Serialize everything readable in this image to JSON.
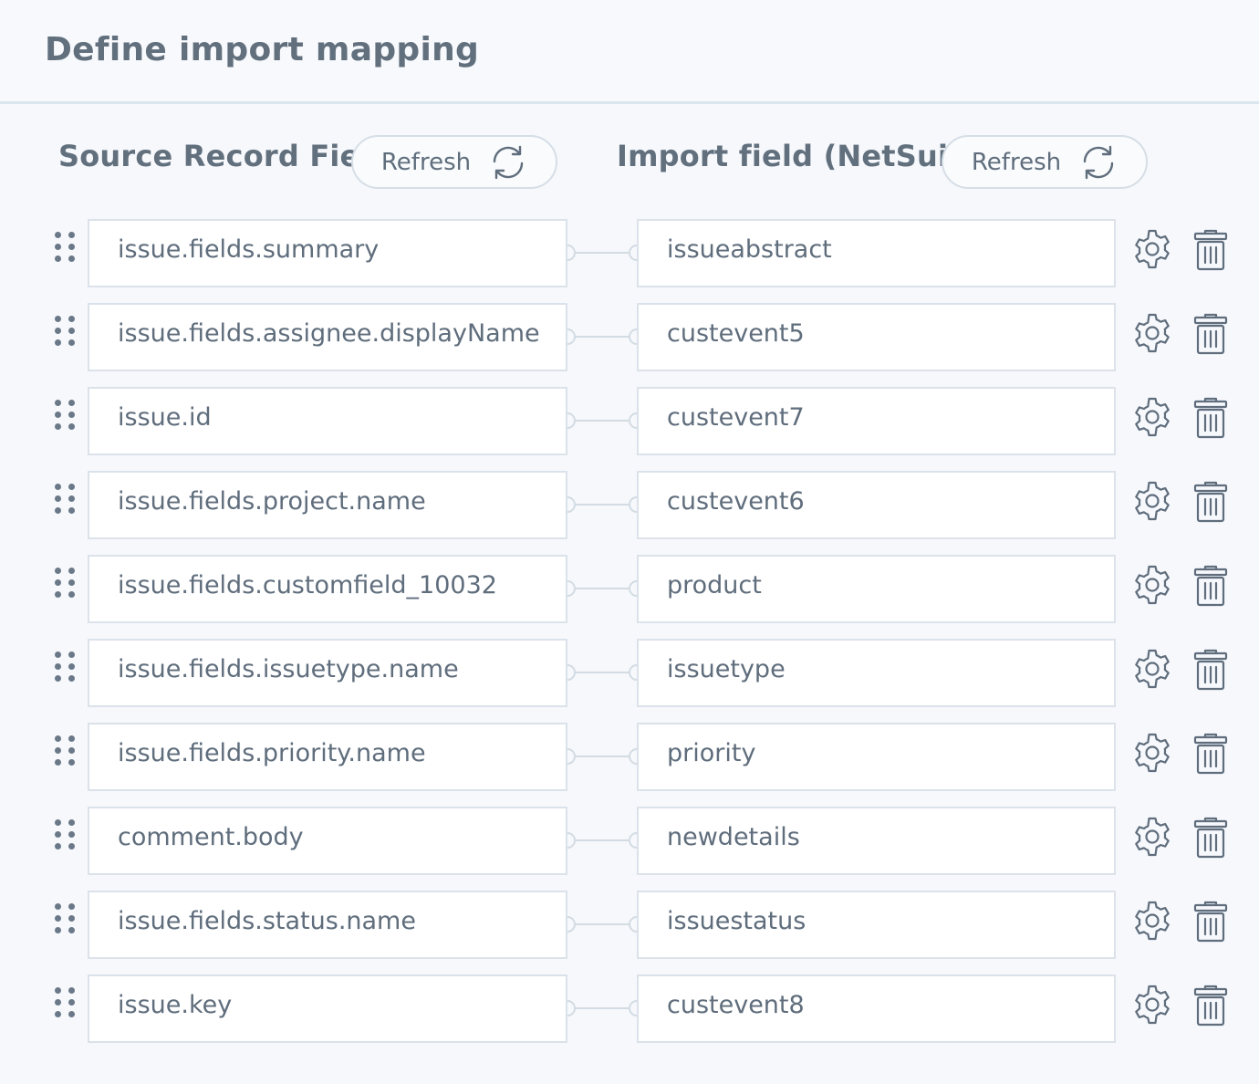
{
  "header": {
    "title": "Define import mapping"
  },
  "columns": {
    "source_title": "Source Record Field",
    "source_refresh_label": "Refresh",
    "import_title": "Import field (NetSuite)",
    "import_refresh_label": "Refresh"
  },
  "icons": {
    "refresh": "refresh-icon",
    "drag": "drag-handle-icon",
    "settings": "gear-icon",
    "delete": "trash-icon"
  },
  "mappings": [
    {
      "source": "issue.fields.summary",
      "target": "issueabstract"
    },
    {
      "source": "issue.fields.assignee.displayName",
      "target": "custevent5"
    },
    {
      "source": "issue.id",
      "target": "custevent7"
    },
    {
      "source": "issue.fields.project.name",
      "target": "custevent6"
    },
    {
      "source": "issue.fields.customfield_10032",
      "target": "product"
    },
    {
      "source": "issue.fields.issuetype.name",
      "target": "issuetype"
    },
    {
      "source": "issue.fields.priority.name",
      "target": "priority"
    },
    {
      "source": "comment.body",
      "target": "newdetails"
    },
    {
      "source": "issue.fields.status.name",
      "target": "issuestatus"
    },
    {
      "source": "issue.key",
      "target": "custevent8"
    }
  ]
}
